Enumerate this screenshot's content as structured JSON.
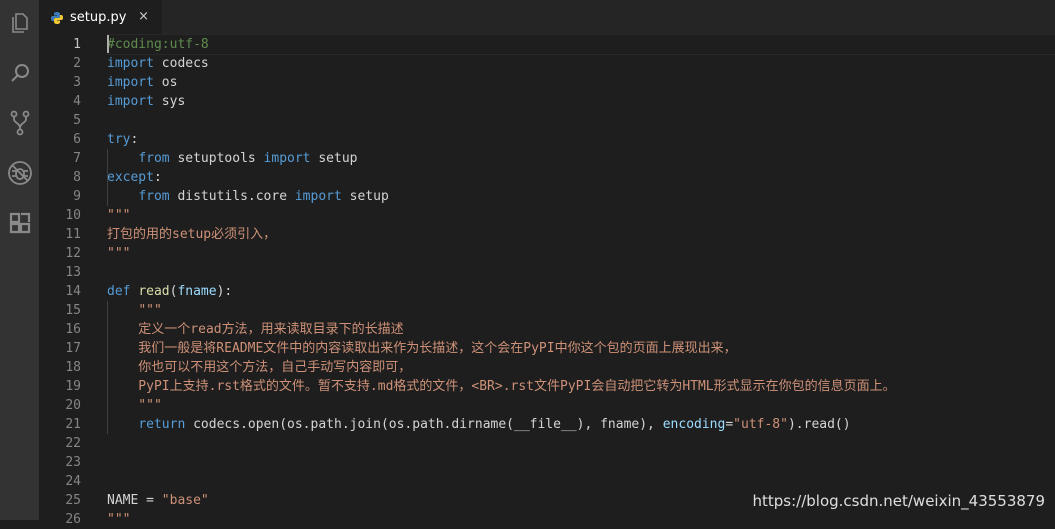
{
  "tab": {
    "title": "setup.py",
    "close_glyph": "×",
    "icon": "python-icon"
  },
  "activity_bar": [
    "explorer-icon",
    "search-icon",
    "source-control-icon",
    "debug-icon",
    "extensions-icon"
  ],
  "watermark": "https://blog.csdn.net/weixin_43553879",
  "colors": {
    "keyword": "#569cd6",
    "comment": "#608b4e",
    "string": "#ce9178",
    "function": "#dcdcaa",
    "parameter": "#9cdcfe",
    "text": "#d4d4d4"
  },
  "active_line": 1,
  "lines": [
    {
      "n": "1",
      "t": [
        {
          "c": "cm",
          "s": "#coding:utf-8"
        }
      ]
    },
    {
      "n": "2",
      "t": [
        {
          "c": "kw",
          "s": "import"
        },
        {
          "c": "nm",
          "s": " codecs"
        }
      ]
    },
    {
      "n": "3",
      "t": [
        {
          "c": "kw",
          "s": "import"
        },
        {
          "c": "nm",
          "s": " os"
        }
      ]
    },
    {
      "n": "4",
      "t": [
        {
          "c": "kw",
          "s": "import"
        },
        {
          "c": "nm",
          "s": " sys"
        }
      ]
    },
    {
      "n": "5",
      "t": []
    },
    {
      "n": "6",
      "t": [
        {
          "c": "kw",
          "s": "try"
        },
        {
          "c": "nm",
          "s": ":"
        }
      ]
    },
    {
      "n": "7",
      "t": [
        {
          "c": "nm",
          "s": "    "
        },
        {
          "c": "kw",
          "s": "from"
        },
        {
          "c": "nm",
          "s": " setuptools "
        },
        {
          "c": "kw",
          "s": "import"
        },
        {
          "c": "nm",
          "s": " setup"
        }
      ]
    },
    {
      "n": "8",
      "t": [
        {
          "c": "kw",
          "s": "except"
        },
        {
          "c": "nm",
          "s": ":"
        }
      ]
    },
    {
      "n": "9",
      "t": [
        {
          "c": "nm",
          "s": "    "
        },
        {
          "c": "kw",
          "s": "from"
        },
        {
          "c": "nm",
          "s": " distutils.core "
        },
        {
          "c": "kw",
          "s": "import"
        },
        {
          "c": "nm",
          "s": " setup"
        }
      ]
    },
    {
      "n": "10",
      "t": [
        {
          "c": "st",
          "s": "\"\"\""
        }
      ]
    },
    {
      "n": "11",
      "t": [
        {
          "c": "st",
          "s": "打包的用的setup必须引入，"
        }
      ]
    },
    {
      "n": "12",
      "t": [
        {
          "c": "st",
          "s": "\"\"\""
        }
      ]
    },
    {
      "n": "13",
      "t": []
    },
    {
      "n": "14",
      "t": [
        {
          "c": "kw",
          "s": "def"
        },
        {
          "c": "nm",
          "s": " "
        },
        {
          "c": "fn",
          "s": "read"
        },
        {
          "c": "nm",
          "s": "("
        },
        {
          "c": "pa",
          "s": "fname"
        },
        {
          "c": "nm",
          "s": "):"
        }
      ]
    },
    {
      "n": "15",
      "t": [
        {
          "c": "nm",
          "s": "    "
        },
        {
          "c": "st",
          "s": "\"\"\""
        }
      ]
    },
    {
      "n": "16",
      "t": [
        {
          "c": "st",
          "s": "    定义一个read方法，用来读取目录下的长描述"
        }
      ]
    },
    {
      "n": "17",
      "t": [
        {
          "c": "st",
          "s": "    我们一般是将README文件中的内容读取出来作为长描述，这个会在PyPI中你这个包的页面上展现出来，"
        }
      ]
    },
    {
      "n": "18",
      "t": [
        {
          "c": "st",
          "s": "    你也可以不用这个方法，自己手动写内容即可，"
        }
      ]
    },
    {
      "n": "19",
      "t": [
        {
          "c": "st",
          "s": "    PyPI上支持.rst格式的文件。暂不支持.md格式的文件，<BR>.rst文件PyPI会自动把它转为HTML形式显示在你包的信息页面上。"
        }
      ]
    },
    {
      "n": "20",
      "t": [
        {
          "c": "st",
          "s": "    \"\"\""
        }
      ]
    },
    {
      "n": "21",
      "t": [
        {
          "c": "nm",
          "s": "    "
        },
        {
          "c": "kw",
          "s": "return"
        },
        {
          "c": "nm",
          "s": " codecs.open(os.path.join(os.path.dirname(__file__), fname), "
        },
        {
          "c": "pa",
          "s": "encoding"
        },
        {
          "c": "nm",
          "s": "="
        },
        {
          "c": "st",
          "s": "\"utf-8\""
        },
        {
          "c": "nm",
          "s": ").read()"
        }
      ]
    },
    {
      "n": "22",
      "t": []
    },
    {
      "n": "23",
      "t": []
    },
    {
      "n": "24",
      "t": []
    },
    {
      "n": "25",
      "t": [
        {
          "c": "nm",
          "s": "NAME = "
        },
        {
          "c": "st",
          "s": "\"base\""
        }
      ]
    },
    {
      "n": "26",
      "t": [
        {
          "c": "st",
          "s": "\"\"\""
        }
      ]
    }
  ]
}
